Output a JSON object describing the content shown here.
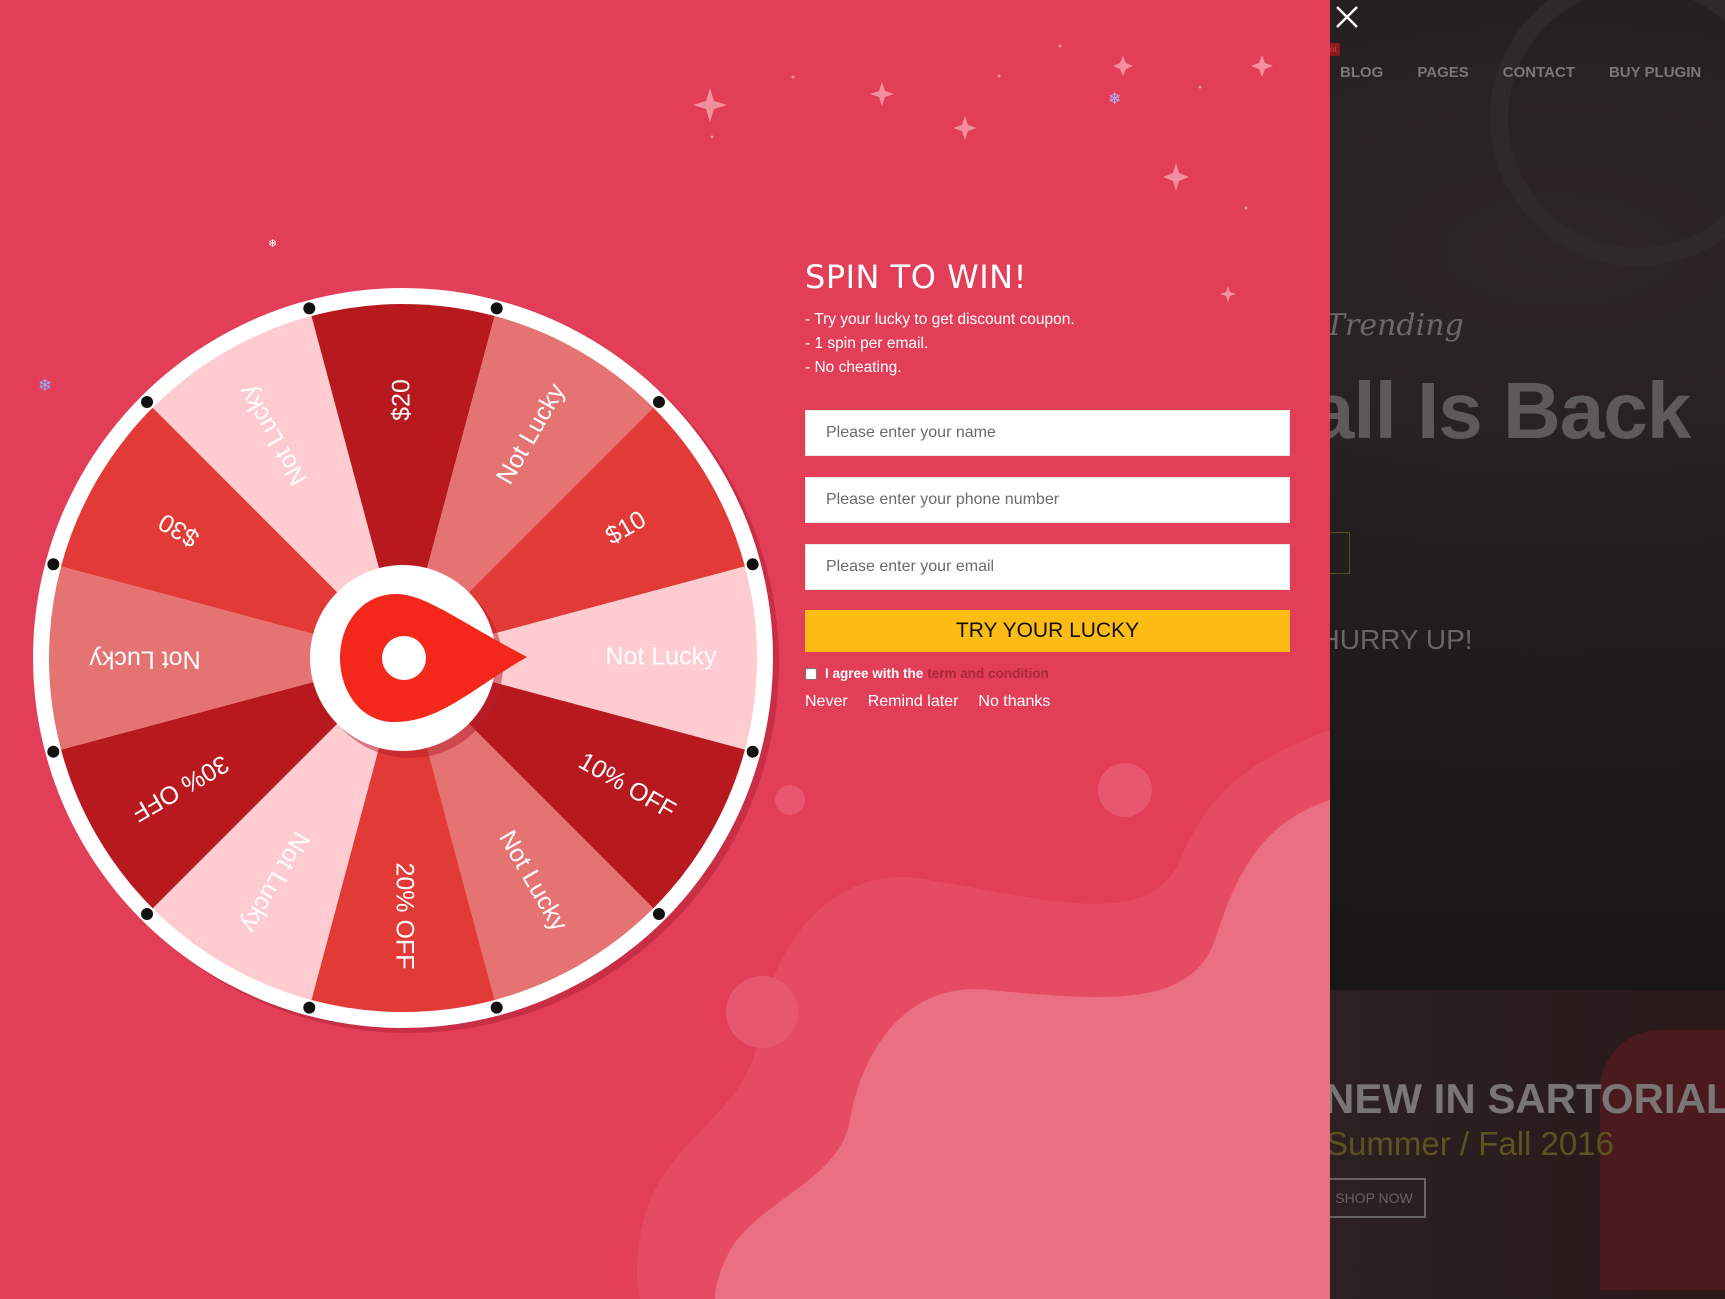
{
  "site": {
    "nav": [
      "BLOG",
      "PAGES",
      "CONTACT",
      "BUY PLUGIN"
    ],
    "hero_kicker": "Trending",
    "hero_title": "Fall Is Back",
    "hero_tagline": "F, HURRY UP!",
    "banner_title": "NEW IN SARTORIAL",
    "banner_subtitle": "Summer / Fall 2016",
    "banner_button": "SHOP NOW"
  },
  "wheel": {
    "segments": [
      "$20",
      "Not Lucky",
      "$10",
      "Not Lucky",
      "10% OFF",
      "Not Lucky",
      "20% OFF",
      "Not Lucky",
      "30% OFF",
      "Not Lucky",
      "$30",
      "Not Lucky"
    ],
    "colors": [
      "#b8191f",
      "#e47372",
      "#e23a36",
      "#fecbd1",
      "#b8191f",
      "#e47372",
      "#e23a36",
      "#fecbd1",
      "#b8191f",
      "#e47372",
      "#e23a36",
      "#fecbd1"
    ],
    "pointer_color": "#f3281b"
  },
  "form": {
    "title": "SPIN TO WIN!",
    "rules": [
      "- Try your lucky to get discount coupon.",
      "- 1 spin per email.",
      "- No cheating."
    ],
    "name_placeholder": "Please enter your name",
    "phone_placeholder": "Please enter your phone number",
    "email_placeholder": "Please enter your email",
    "button_label": "TRY YOUR LUCKY",
    "agree_text": "I agree with the",
    "term_link": "term and condition",
    "links": {
      "never": "Never",
      "remind": "Remind later",
      "no_thanks": "No thanks"
    }
  },
  "colors": {
    "panel": "#e23e57",
    "button": "#fcbc14",
    "term_link": "#a8273a"
  }
}
